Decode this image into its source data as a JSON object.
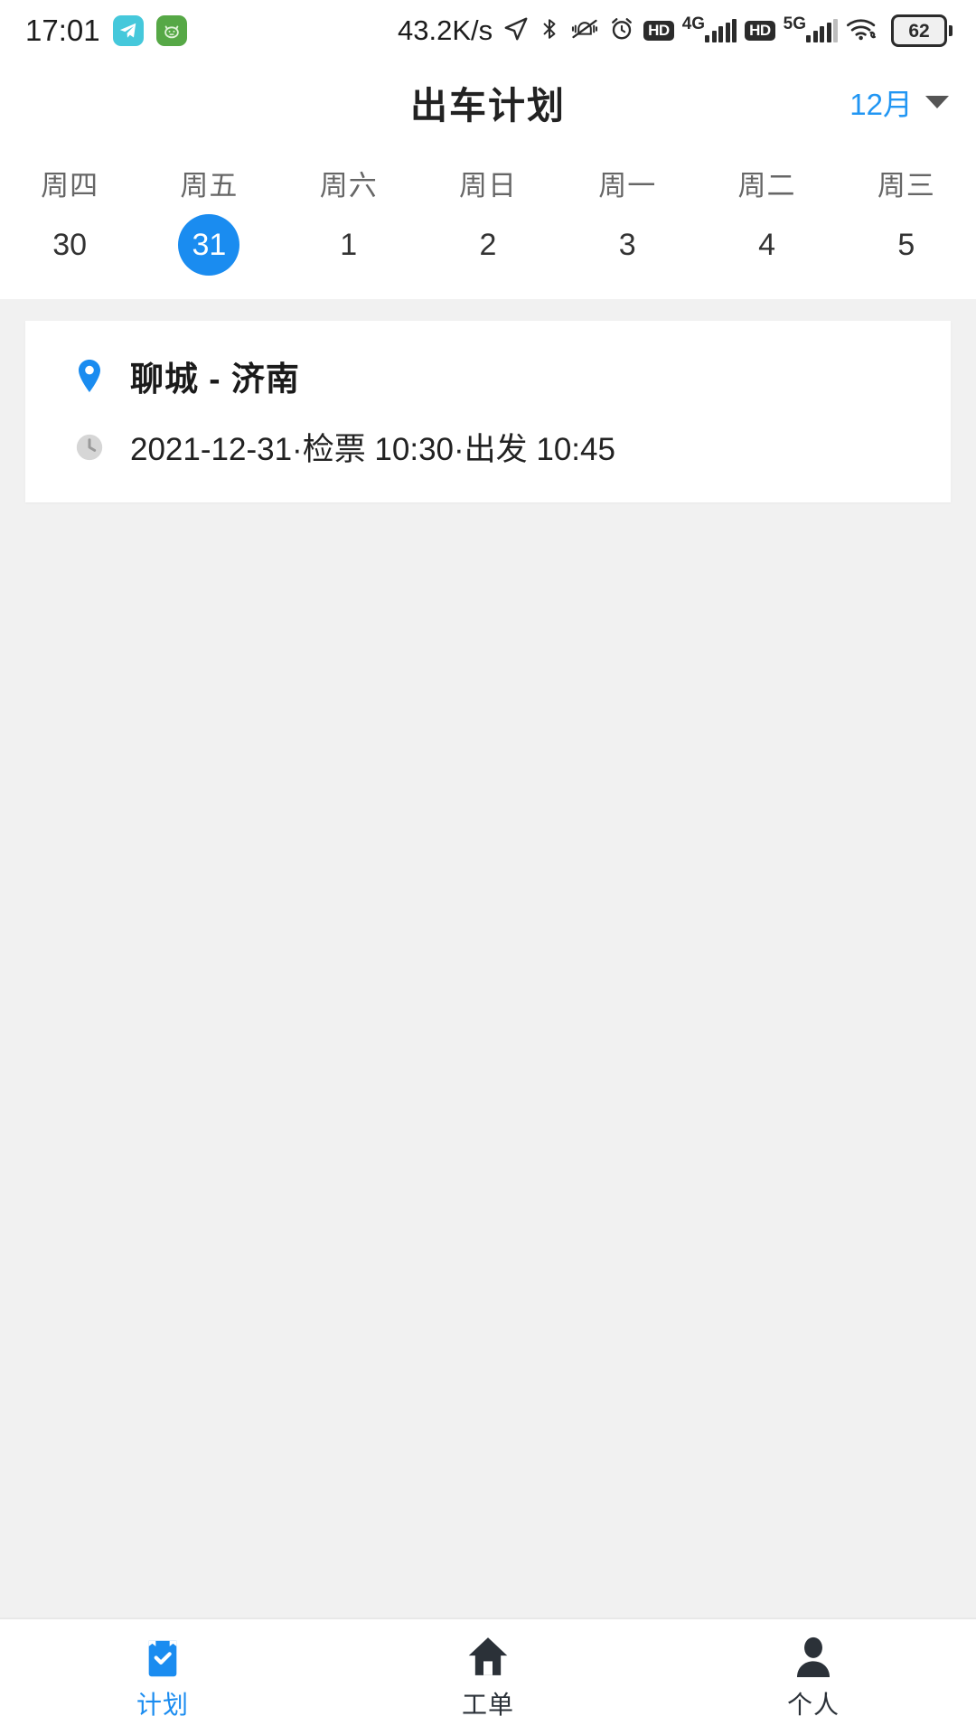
{
  "status_bar": {
    "time": "17:01",
    "network_speed": "43.2K/s",
    "app_icons": [
      {
        "name": "telegram-app-icon",
        "color": "#45c8db"
      },
      {
        "name": "cat-app-icon",
        "color": "#56a846"
      }
    ],
    "icons": [
      "location-arrow-icon",
      "bluetooth-icon",
      "vibrate-off-icon",
      "alarm-clock-icon",
      "hd-badge-icon",
      "signal-4g-icon",
      "hd-badge-icon-2",
      "signal-5g-icon",
      "wifi-icon",
      "battery-icon"
    ],
    "sim1_network": "4G",
    "sim2_network": "5G",
    "hd_label": "HD",
    "battery_percent": "62"
  },
  "header": {
    "title": "出车计划",
    "month_label": "12月",
    "accent_color": "#2196f3"
  },
  "week_strip": {
    "selected_index": 1,
    "selected_color": "#1a8cf0",
    "days": [
      {
        "weekday": "周四",
        "date": "30"
      },
      {
        "weekday": "周五",
        "date": "31"
      },
      {
        "weekday": "周六",
        "date": "1"
      },
      {
        "weekday": "周日",
        "date": "2"
      },
      {
        "weekday": "周一",
        "date": "3"
      },
      {
        "weekday": "周二",
        "date": "4"
      },
      {
        "weekday": "周三",
        "date": "5"
      }
    ]
  },
  "trips": [
    {
      "route": "聊城 - 济南",
      "detail": "2021-12-31·检票 10:30·出发 10:45"
    }
  ],
  "bottom_nav": {
    "active_index": 0,
    "active_color": "#1a8cf0",
    "items": [
      {
        "label": "计划",
        "icon": "clipboard-check-icon"
      },
      {
        "label": "工单",
        "icon": "home-icon"
      },
      {
        "label": "个人",
        "icon": "person-icon"
      }
    ]
  }
}
